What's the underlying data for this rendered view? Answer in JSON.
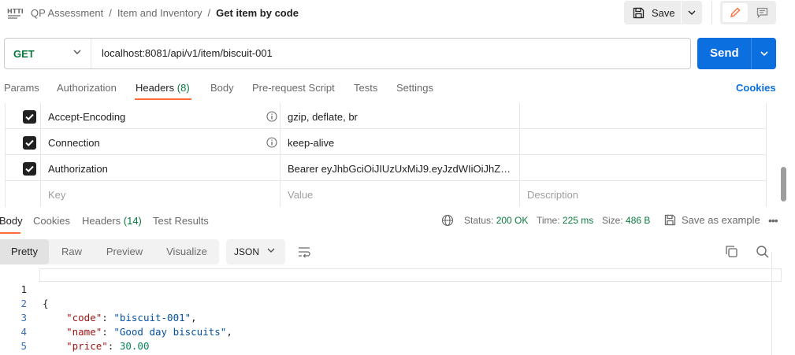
{
  "breadcrumb": {
    "icon": "http-icon",
    "items": [
      "QP Assessment",
      "Item and Inventory"
    ],
    "separator": "/",
    "current": "Get item by code"
  },
  "toolbar": {
    "save_label": "Save"
  },
  "request": {
    "method": "GET",
    "url": "localhost:8081/api/v1/item/biscuit-001",
    "send_label": "Send"
  },
  "request_tabs": {
    "params": "Params",
    "authorization": "Authorization",
    "headers": "Headers",
    "headers_count": "(8)",
    "body": "Body",
    "prerequest": "Pre-request Script",
    "tests": "Tests",
    "settings": "Settings",
    "cookies": "Cookies"
  },
  "headers_table": {
    "rows": [
      {
        "checked": true,
        "key": "Accept-Encoding",
        "value": "gzip, deflate, br"
      },
      {
        "checked": true,
        "key": "Connection",
        "value": "keep-alive"
      },
      {
        "checked": true,
        "key": "Authorization",
        "value": "Bearer eyJhbGciOiJIUzUxMiJ9.eyJzdWIiOiJhZG1p..."
      }
    ],
    "placeholders": {
      "key": "Key",
      "value": "Value",
      "description": "Description"
    }
  },
  "response": {
    "tabs": {
      "body": "Body",
      "cookies": "Cookies",
      "headers": "Headers",
      "headers_count": "(14)",
      "test_results": "Test Results"
    },
    "status_label": "Status:",
    "status_value": "200 OK",
    "time_label": "Time:",
    "time_value": "225 ms",
    "size_label": "Size:",
    "size_value": "486 B",
    "save_example": "Save as example"
  },
  "view": {
    "modes": [
      "Pretty",
      "Raw",
      "Preview",
      "Visualize"
    ],
    "active_mode": "Pretty",
    "format": "JSON"
  },
  "body_lines": [
    {
      "n": "1",
      "text": "{"
    },
    {
      "n": "2",
      "key": "\"code\"",
      "value": "\"biscuit-001\"",
      "trail": ","
    },
    {
      "n": "3",
      "key": "\"name\"",
      "value": "\"Good day biscuits\"",
      "trail": ","
    },
    {
      "n": "4",
      "key": "\"price\"",
      "number": "30.00",
      "trail": ""
    },
    {
      "n": "5",
      "text": "}"
    }
  ],
  "colors": {
    "accent": "#ff6c37",
    "primary": "#0b6fe0",
    "success": "#0b7a3e"
  }
}
